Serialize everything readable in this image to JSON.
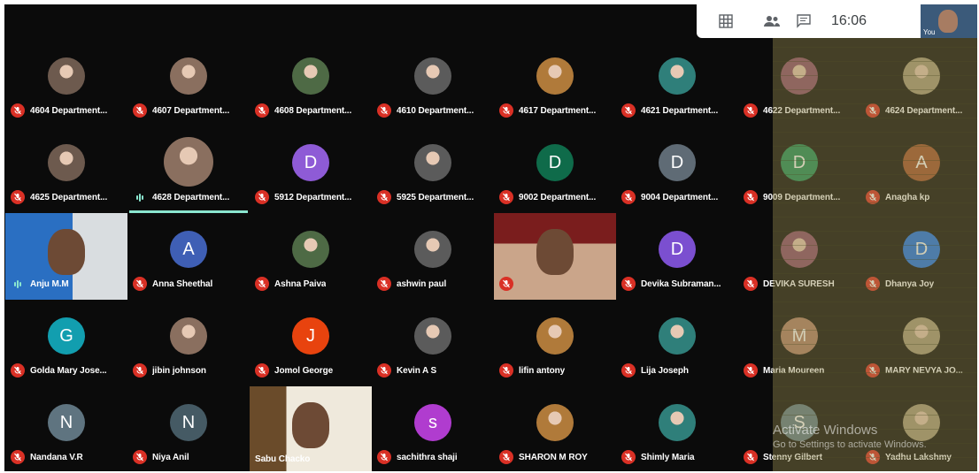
{
  "topbar": {
    "clock": "16:06",
    "grid_icon": "grid-icon",
    "people_icon": "people-icon",
    "chat_icon": "chat-icon"
  },
  "self_view": {
    "label": "You"
  },
  "watermark": {
    "line1": "Activate Windows",
    "line2": "Go to Settings to activate Windows."
  },
  "colors": {
    "muted_mic": "#d93025",
    "speaking": "#8ae6cf",
    "background": "#0b0b0b"
  },
  "participants": [
    {
      "name": "4604 Department...",
      "avatar": "photo",
      "muted": true
    },
    {
      "name": "4607 Department...",
      "avatar": "photo",
      "muted": true
    },
    {
      "name": "4608 Department...",
      "avatar": "photo",
      "muted": true
    },
    {
      "name": "4610 Department...",
      "avatar": "photo",
      "muted": true
    },
    {
      "name": "4617 Department...",
      "avatar": "photo",
      "muted": true
    },
    {
      "name": "4621 Department...",
      "avatar": "photo",
      "muted": true
    },
    {
      "name": "4622 Department...",
      "avatar": "photo",
      "muted": true
    },
    {
      "name": "4624 Department...",
      "avatar": "photo",
      "muted": true
    },
    {
      "name": "4625 Department...",
      "avatar": "photo",
      "muted": true
    },
    {
      "name": "4628 Department...",
      "avatar": "photo",
      "muted": false,
      "speaking": true
    },
    {
      "name": "5912 Department...",
      "avatar": "letter",
      "letter": "D",
      "color": "#8e5bd6",
      "muted": true
    },
    {
      "name": "5925 Department...",
      "avatar": "photo",
      "muted": true
    },
    {
      "name": "9002 Department...",
      "avatar": "letter",
      "letter": "D",
      "color": "#0f6b4a",
      "muted": true
    },
    {
      "name": "9004 Department...",
      "avatar": "letter",
      "letter": "D",
      "color": "#5f6b75",
      "muted": true
    },
    {
      "name": "9009 Department...",
      "avatar": "letter",
      "letter": "D",
      "color": "#1e8e5a",
      "muted": true
    },
    {
      "name": "Anagha kp",
      "avatar": "letter",
      "letter": "A",
      "color": "#a0522d",
      "muted": true
    },
    {
      "name": "Anju M.M",
      "avatar": "video",
      "muted": false,
      "speaking": true
    },
    {
      "name": "Anna Sheethal",
      "avatar": "letter",
      "letter": "A",
      "color": "#3f5fb5",
      "muted": true
    },
    {
      "name": "Ashna Paiva",
      "avatar": "photo",
      "muted": true
    },
    {
      "name": "ashwin paul",
      "avatar": "photo",
      "muted": true
    },
    {
      "name": "",
      "avatar": "video",
      "muted": true
    },
    {
      "name": "Devika Subraman...",
      "avatar": "letter",
      "letter": "D",
      "color": "#7b4fd0",
      "muted": true
    },
    {
      "name": "DEVIKA SURESH",
      "avatar": "photo",
      "muted": true
    },
    {
      "name": "Dhanya Joy",
      "avatar": "letter",
      "letter": "D",
      "color": "#1a73e8",
      "muted": true
    },
    {
      "name": "Golda Mary Jose...",
      "avatar": "letter",
      "letter": "G",
      "color": "#129eaf",
      "muted": true
    },
    {
      "name": "jibin johnson",
      "avatar": "photo",
      "muted": true
    },
    {
      "name": "Jomol George",
      "avatar": "letter",
      "letter": "J",
      "color": "#e8430e",
      "muted": true
    },
    {
      "name": "Kevin A S",
      "avatar": "photo",
      "muted": true
    },
    {
      "name": "lifin antony",
      "avatar": "photo",
      "muted": true
    },
    {
      "name": "Lija Joseph",
      "avatar": "photo",
      "muted": true
    },
    {
      "name": "Maria Moureen",
      "avatar": "letter",
      "letter": "M",
      "color": "#b0806a",
      "muted": true
    },
    {
      "name": "MARY NEVYA JO...",
      "avatar": "photo",
      "muted": true
    },
    {
      "name": "Nandana V.R",
      "avatar": "letter",
      "letter": "N",
      "color": "#5f7480",
      "muted": true
    },
    {
      "name": "Niya Anil",
      "avatar": "letter",
      "letter": "N",
      "color": "#455a64",
      "muted": true
    },
    {
      "name": "Sabu Chacko",
      "avatar": "video",
      "muted": false
    },
    {
      "name": "sachithra shaji",
      "avatar": "letter",
      "letter": "s",
      "color": "#b03ccf",
      "muted": true
    },
    {
      "name": "SHARON M ROY",
      "avatar": "photo",
      "muted": true
    },
    {
      "name": "Shimly Maria",
      "avatar": "photo",
      "muted": true
    },
    {
      "name": "Stenny Gilbert",
      "avatar": "letter",
      "letter": "S",
      "color": "#607d8b",
      "muted": true
    },
    {
      "name": "Yadhu Lakshmy",
      "avatar": "photo",
      "muted": true
    }
  ]
}
